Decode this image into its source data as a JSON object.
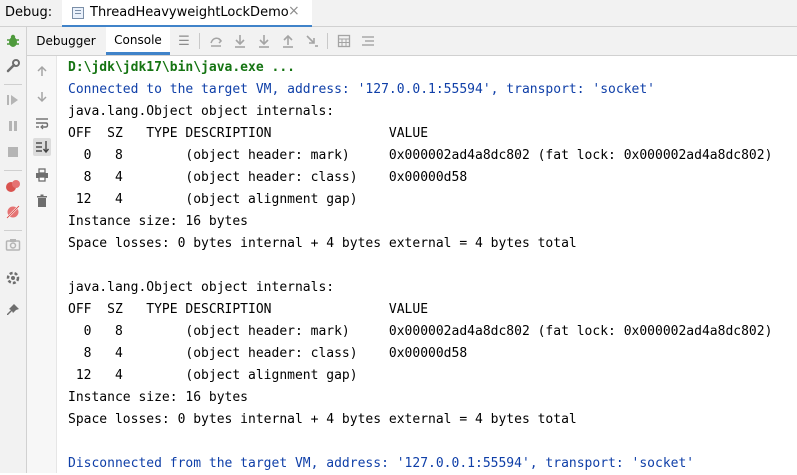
{
  "titlebar": {
    "label": "Debug:",
    "tab_label": "ThreadHeavyweightLockDemo",
    "tab_close": "×"
  },
  "toolbar": {
    "debugger_tab": "Debugger",
    "console_tab": "Console"
  },
  "console": {
    "lines": [
      {
        "kind": "cmd",
        "text": "D:\\jdk\\jdk17\\bin\\java.exe ..."
      },
      {
        "kind": "sys",
        "text": "Connected to the target VM, address: '127.0.0.1:55594', transport: 'socket'"
      },
      {
        "kind": "out",
        "text": "java.lang.Object object internals:"
      },
      {
        "kind": "out",
        "text": "OFF  SZ   TYPE DESCRIPTION               VALUE"
      },
      {
        "kind": "out",
        "text": "  0   8        (object header: mark)     0x000002ad4a8dc802 (fat lock: 0x000002ad4a8dc802)"
      },
      {
        "kind": "out",
        "text": "  8   4        (object header: class)    0x00000d58"
      },
      {
        "kind": "out",
        "text": " 12   4        (object alignment gap)"
      },
      {
        "kind": "out",
        "text": "Instance size: 16 bytes"
      },
      {
        "kind": "out",
        "text": "Space losses: 0 bytes internal + 4 bytes external = 4 bytes total"
      },
      {
        "kind": "out",
        "text": ""
      },
      {
        "kind": "out",
        "text": "java.lang.Object object internals:"
      },
      {
        "kind": "out",
        "text": "OFF  SZ   TYPE DESCRIPTION               VALUE"
      },
      {
        "kind": "out",
        "text": "  0   8        (object header: mark)     0x000002ad4a8dc802 (fat lock: 0x000002ad4a8dc802)"
      },
      {
        "kind": "out",
        "text": "  8   4        (object header: class)    0x00000d58"
      },
      {
        "kind": "out",
        "text": " 12   4        (object alignment gap)"
      },
      {
        "kind": "out",
        "text": "Instance size: 16 bytes"
      },
      {
        "kind": "out",
        "text": "Space losses: 0 bytes internal + 4 bytes external = 4 bytes total"
      },
      {
        "kind": "out",
        "text": ""
      },
      {
        "kind": "sys",
        "text": "Disconnected from the target VM, address: '127.0.0.1:55594', transport: 'socket'"
      }
    ]
  },
  "icons": {
    "left_toolbar": [
      "debug-bug-icon",
      "wrench-icon",
      "resume-icon",
      "pause-icon",
      "stop-icon",
      "view-breakpoints-icon",
      "mute-breakpoints-icon",
      "camera-icon",
      "settings-icon",
      "pin-icon"
    ],
    "header_toolbar": [
      "menu-icon",
      "show-execution-point-icon",
      "step-over-icon",
      "step-into-icon",
      "step-out-icon",
      "run-to-cursor-icon",
      "evaluate-expression-icon",
      "trace-icon"
    ],
    "console_toolbar": [
      "scroll-up-icon",
      "scroll-down-icon",
      "soft-wrap-icon",
      "scroll-to-end-icon",
      "print-icon",
      "clear-icon"
    ]
  },
  "colors": {
    "accent": "#4083c9",
    "command_text": "#157412",
    "system_text": "#0f3fa8",
    "debug_green": "#4e9a3c",
    "breakpoint_red": "#d9534f"
  }
}
